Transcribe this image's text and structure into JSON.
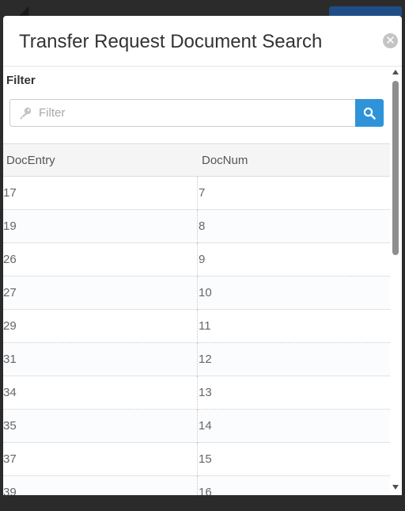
{
  "modal": {
    "title": "Transfer Request Document Search",
    "close_icon": "close-icon"
  },
  "filter": {
    "label": "Filter",
    "placeholder": "Filter",
    "value": "",
    "icon": "key-icon",
    "search_icon": "search-icon"
  },
  "table": {
    "columns": [
      "DocEntry",
      "DocNum"
    ],
    "rows": [
      [
        "17",
        "7"
      ],
      [
        "19",
        "8"
      ],
      [
        "26",
        "9"
      ],
      [
        "27",
        "10"
      ],
      [
        "29",
        "11"
      ],
      [
        "31",
        "12"
      ],
      [
        "34",
        "13"
      ],
      [
        "35",
        "14"
      ],
      [
        "37",
        "15"
      ],
      [
        "39",
        "16"
      ]
    ]
  },
  "colors": {
    "accent": "#2e93d8",
    "backdrop": "#2b2b2b"
  }
}
